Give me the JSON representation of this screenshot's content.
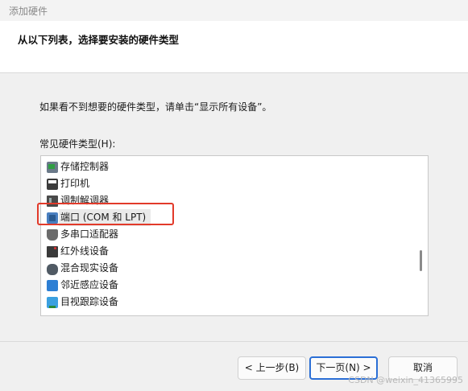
{
  "window": {
    "title": "添加硬件"
  },
  "header": {
    "heading": "从以下列表，选择要安装的硬件类型"
  },
  "main": {
    "instruction": "如果看不到想要的硬件类型，请单击“显示所有设备”。",
    "list_label": "常见硬件类型(H):",
    "items": [
      {
        "label": "存储控制器",
        "icon": "storage-controller-icon"
      },
      {
        "label": "打印机",
        "icon": "printer-icon"
      },
      {
        "label": "调制解调器",
        "icon": "modem-icon"
      },
      {
        "label": "端口 (COM 和 LPT)",
        "icon": "port-icon"
      },
      {
        "label": "多串口适配器",
        "icon": "multiport-serial-icon"
      },
      {
        "label": "红外线设备",
        "icon": "infrared-icon"
      },
      {
        "label": "混合现实设备",
        "icon": "mixed-reality-icon"
      },
      {
        "label": "邻近感应设备",
        "icon": "proximity-icon"
      },
      {
        "label": "目视跟踪设备",
        "icon": "eye-tracking-icon"
      }
    ],
    "selected_index": 3
  },
  "buttons": {
    "back": "< 上一步(B)",
    "next": "下一页(N) >",
    "cancel": "取消"
  },
  "watermark": "CSDN @weixin_41365995",
  "colors": {
    "highlight": "#e23a2a",
    "focus": "#2b6fd6"
  }
}
